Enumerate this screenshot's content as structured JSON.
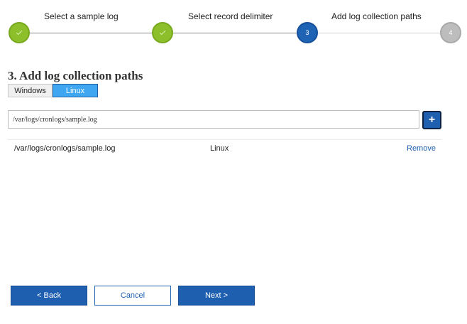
{
  "wizard": {
    "steps": [
      {
        "label": "Select a sample log",
        "number": "",
        "status": "done"
      },
      {
        "label": "Select record delimiter",
        "number": "",
        "status": "done"
      },
      {
        "label": "Add log collection paths",
        "number": "3",
        "status": "active"
      },
      {
        "label": "",
        "number": "4",
        "status": "todo"
      }
    ]
  },
  "page": {
    "title": "3. Add log collection paths"
  },
  "os_tabs": [
    {
      "label": "Windows",
      "selected": false
    },
    {
      "label": "Linux",
      "selected": true
    }
  ],
  "path_input": {
    "value": "/var/logs/cronlogs/sample.log"
  },
  "add_button": {
    "label": "+"
  },
  "paths": [
    {
      "path": "/var/logs/cronlogs/sample.log",
      "os": "Linux",
      "action": "Remove"
    }
  ],
  "footer": {
    "back": "< Back",
    "cancel": "Cancel",
    "next": "Next >"
  },
  "colors": {
    "done": "#8cbf2a",
    "active": "#1f63b5",
    "todo": "#bdbdbd",
    "primary": "#1f5fb0",
    "selected_tab": "#3fa7f2"
  }
}
